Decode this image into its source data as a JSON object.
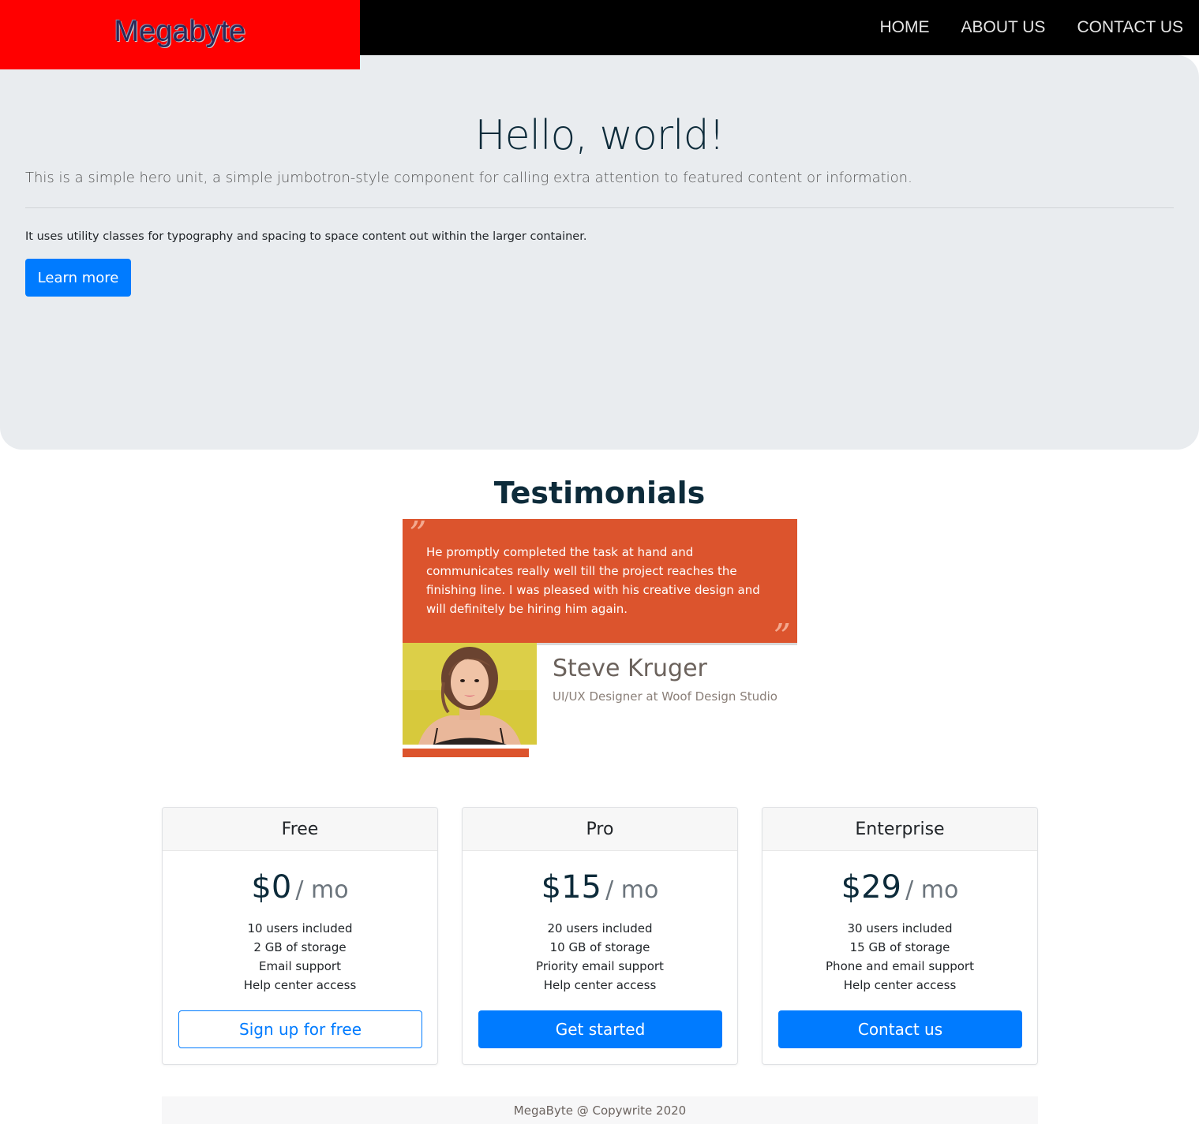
{
  "nav": {
    "brand": "Megabyte",
    "links": [
      "HOME",
      "ABOUT US",
      "CONTACT US"
    ]
  },
  "hero": {
    "title": "Hello, world!",
    "lead": "This is a simple hero unit, a simple jumbotron-style component for calling extra attention to featured content or information.",
    "text": "It uses utility classes for typography and spacing to space content out within the larger container.",
    "button_label": "Learn more"
  },
  "testimonials": {
    "heading": "Testimonials",
    "quote": "He promptly completed the task at hand and communicates really well till the project reaches the finishing line. I was pleased with his creative design and will definitely be hiring him again.",
    "open_mark": "”",
    "close_mark": "”",
    "name": "Steve Kruger",
    "role": "UI/UX Designer at Woof Design Studio"
  },
  "pricing": {
    "per_label": "/ mo",
    "plans": [
      {
        "name": "Free",
        "price": "$0",
        "features": [
          "10 users included",
          "2 GB of storage",
          "Email support",
          "Help center access"
        ],
        "button_label": "Sign up for free"
      },
      {
        "name": "Pro",
        "price": "$15",
        "features": [
          "20 users included",
          "10 GB of storage",
          "Priority email support",
          "Help center access"
        ],
        "button_label": "Get started"
      },
      {
        "name": "Enterprise",
        "price": "$29",
        "features": [
          "30 users included",
          "15 GB of storage",
          "Phone and email support",
          "Help center access"
        ],
        "button_label": "Contact us"
      }
    ]
  },
  "footer": {
    "text": "MegaByte @ Copywrite 2020"
  },
  "colors": {
    "brand_bg": "#ff0000",
    "navbar_bg": "#000000",
    "hero_bg": "#e9ecef",
    "primary": "#007bff",
    "quote_bg": "#dc542d"
  }
}
